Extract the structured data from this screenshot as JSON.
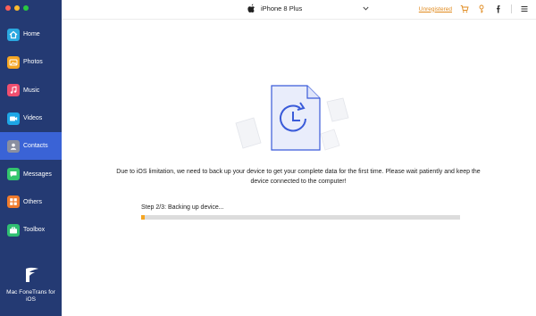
{
  "window": {
    "controls": [
      "close",
      "minimize",
      "zoom"
    ]
  },
  "sidebar": {
    "items": [
      {
        "id": "home",
        "label": "Home",
        "icon": "home-icon",
        "color": "#2aa8e0",
        "active": false
      },
      {
        "id": "photos",
        "label": "Photos",
        "icon": "photos-icon",
        "color": "#f5a623",
        "active": false
      },
      {
        "id": "music",
        "label": "Music",
        "icon": "music-icon",
        "color": "#ef4f6f",
        "active": false
      },
      {
        "id": "videos",
        "label": "Videos",
        "icon": "videos-icon",
        "color": "#1ea6e6",
        "active": false
      },
      {
        "id": "contacts",
        "label": "Contacts",
        "icon": "contacts-icon",
        "color": "#8a8fa0",
        "active": true
      },
      {
        "id": "messages",
        "label": "Messages",
        "icon": "messages-icon",
        "color": "#33c56c",
        "active": false
      },
      {
        "id": "others",
        "label": "Others",
        "icon": "others-icon",
        "color": "#f07b2c",
        "active": false
      },
      {
        "id": "toolbox",
        "label": "Toolbox",
        "icon": "toolbox-icon",
        "color": "#2fbf72",
        "active": false
      }
    ],
    "brand": "Mac FoneTrans for iOS"
  },
  "topbar": {
    "device_name": "iPhone 8 Plus",
    "unregistered": "Unregistered",
    "icons": [
      "cart-icon",
      "key-icon",
      "facebook-icon",
      "menu-icon"
    ]
  },
  "main": {
    "message": "Due to iOS limitation, we need to back up your device to get your complete data for the first time. Please wait patiently and keep the device connected to the computer!",
    "step": "Step 2/3: Backing up device...",
    "progress": 0.01
  },
  "colors": {
    "sidebar_bg": "#243a73",
    "active_item": "#3a63d6",
    "accent": "#3a63d6",
    "progress": "#f5a623",
    "unregistered": "#e08a1e"
  }
}
